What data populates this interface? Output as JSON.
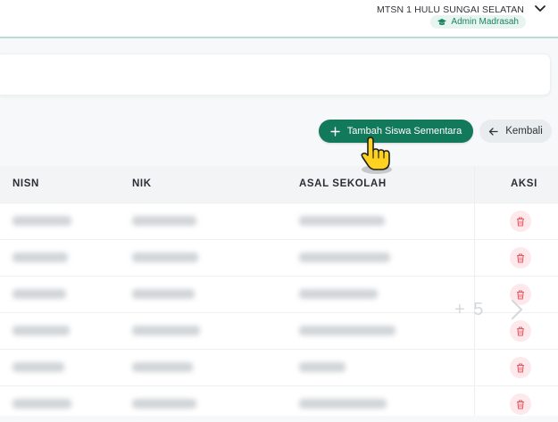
{
  "header": {
    "school_name": "MTSN 1 HULU SUNGAI SELATAN",
    "role_badge": "Admin Madrasah",
    "role_icon": "graduation-cap-icon",
    "dropdown_icon": "chevron-down-icon"
  },
  "actions": {
    "add_label": "Tambah Siswa Sementara",
    "back_label": "Kembali"
  },
  "table": {
    "columns": [
      "NISN",
      "NIK",
      "ASAL SEKOLAH",
      "AKSI"
    ],
    "rows_visible": 6
  },
  "overlay": {
    "count_text": "+ 5"
  },
  "colors": {
    "primary": "#13795b",
    "badge_bg": "#e8f4ef",
    "danger": "#e35d6a",
    "danger_bg": "#fde9eb"
  }
}
